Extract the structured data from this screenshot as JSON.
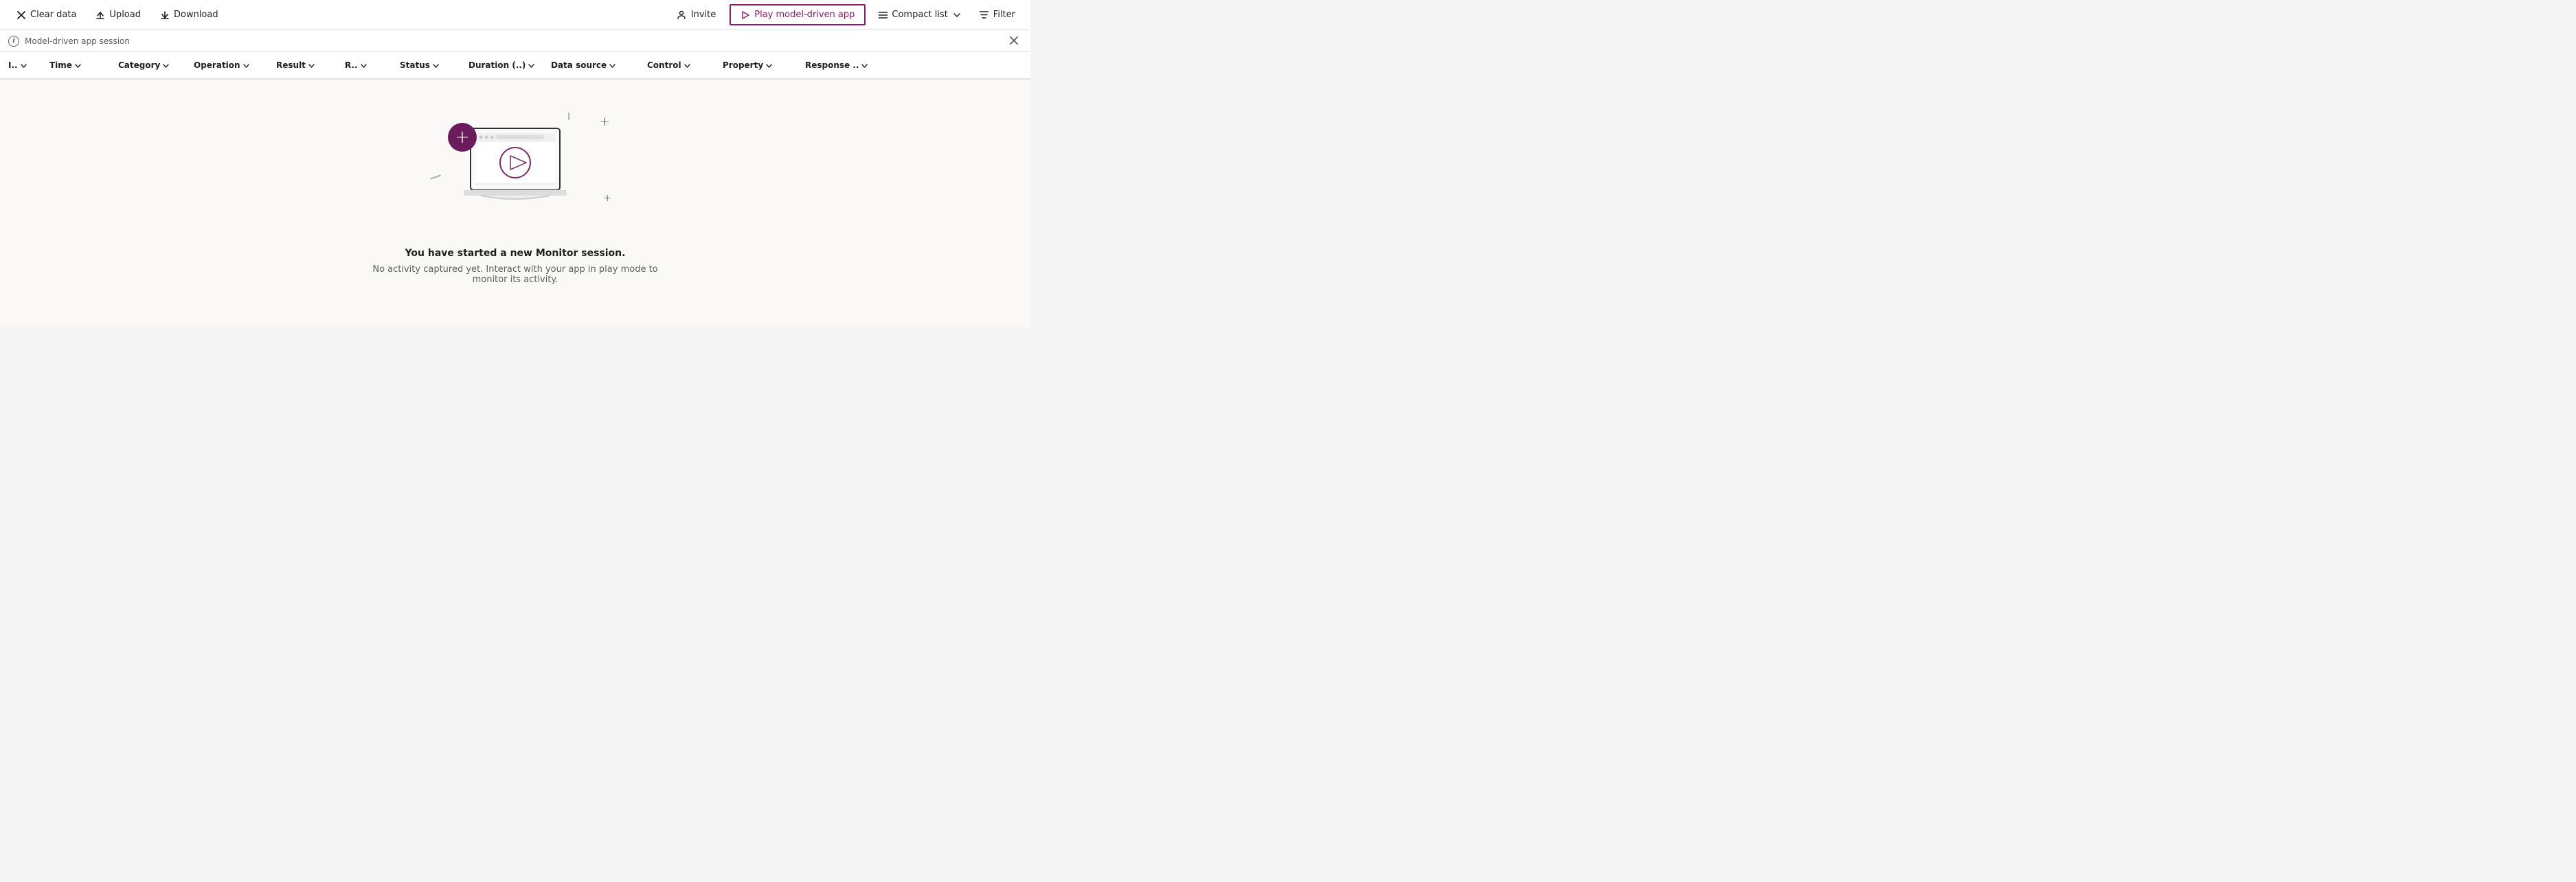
{
  "toolbar": {
    "clear_data_label": "Clear data",
    "upload_label": "Upload",
    "download_label": "Download",
    "invite_label": "Invite",
    "play_model_driven_app_label": "Play model-driven app",
    "compact_list_label": "Compact list",
    "filter_label": "Filter"
  },
  "session_bar": {
    "info_text": "Model-driven app session"
  },
  "columns": [
    {
      "id": "i",
      "label": "I..",
      "class": "col-i"
    },
    {
      "id": "time",
      "label": "Time",
      "class": "col-time"
    },
    {
      "id": "category",
      "label": "Category",
      "class": "col-category"
    },
    {
      "id": "operation",
      "label": "Operation",
      "class": "col-operation"
    },
    {
      "id": "result",
      "label": "Result",
      "class": "col-result"
    },
    {
      "id": "r",
      "label": "R..",
      "class": "col-r"
    },
    {
      "id": "status",
      "label": "Status",
      "class": "col-status"
    },
    {
      "id": "duration",
      "label": "Duration (..)",
      "class": "col-duration"
    },
    {
      "id": "datasource",
      "label": "Data source",
      "class": "col-datasource"
    },
    {
      "id": "control",
      "label": "Control",
      "class": "col-control"
    },
    {
      "id": "property",
      "label": "Property",
      "class": "col-property"
    },
    {
      "id": "response",
      "label": "Response ..",
      "class": "col-response"
    }
  ],
  "empty_state": {
    "title": "You have started a new Monitor session.",
    "subtitle": "No activity captured yet. Interact with your app in play mode to monitor its activity."
  },
  "colors": {
    "accent": "#8b1a6b",
    "accent_dark": "#6b1a5b"
  }
}
